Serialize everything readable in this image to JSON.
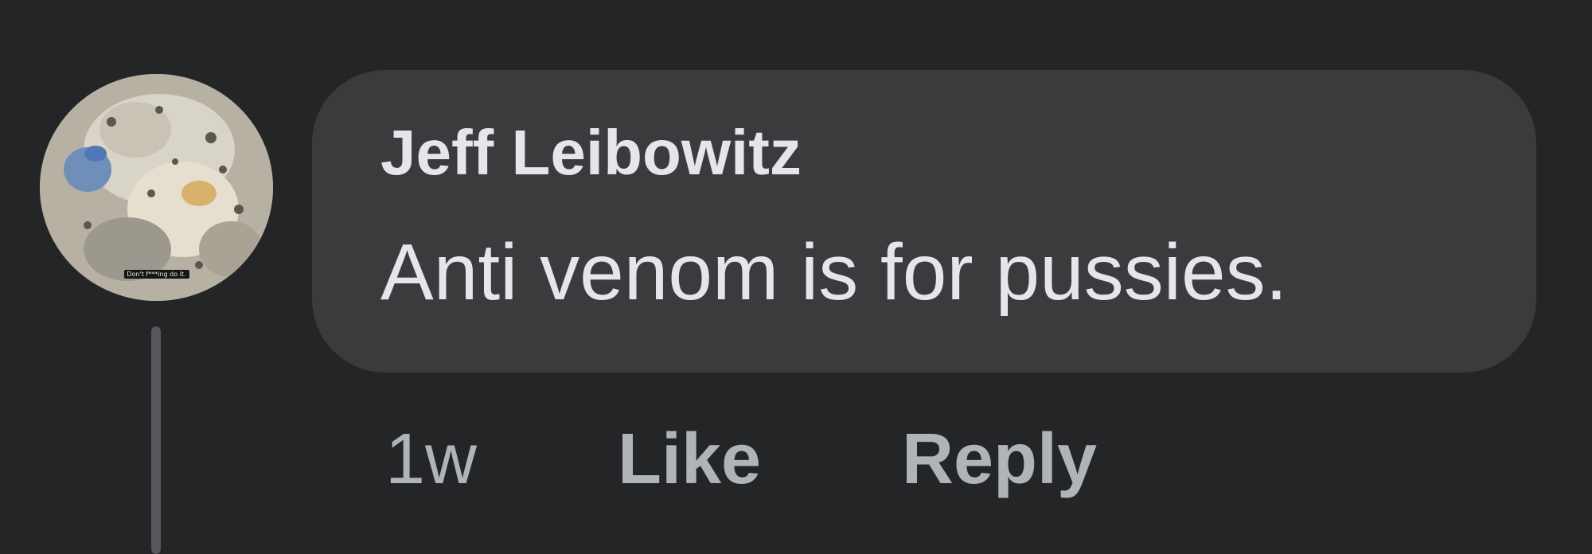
{
  "comment": {
    "author": "Jeff Leibowitz",
    "text": "Anti venom is for pussies.",
    "avatar_caption": "Don't f***ing do it.",
    "timestamp": "1w",
    "actions": {
      "like_label": "Like",
      "reply_label": "Reply"
    }
  },
  "colors": {
    "background": "#242526",
    "bubble": "#3a3b3c",
    "primary_text": "#e4e6eb",
    "secondary_text": "#b0b3b8"
  }
}
